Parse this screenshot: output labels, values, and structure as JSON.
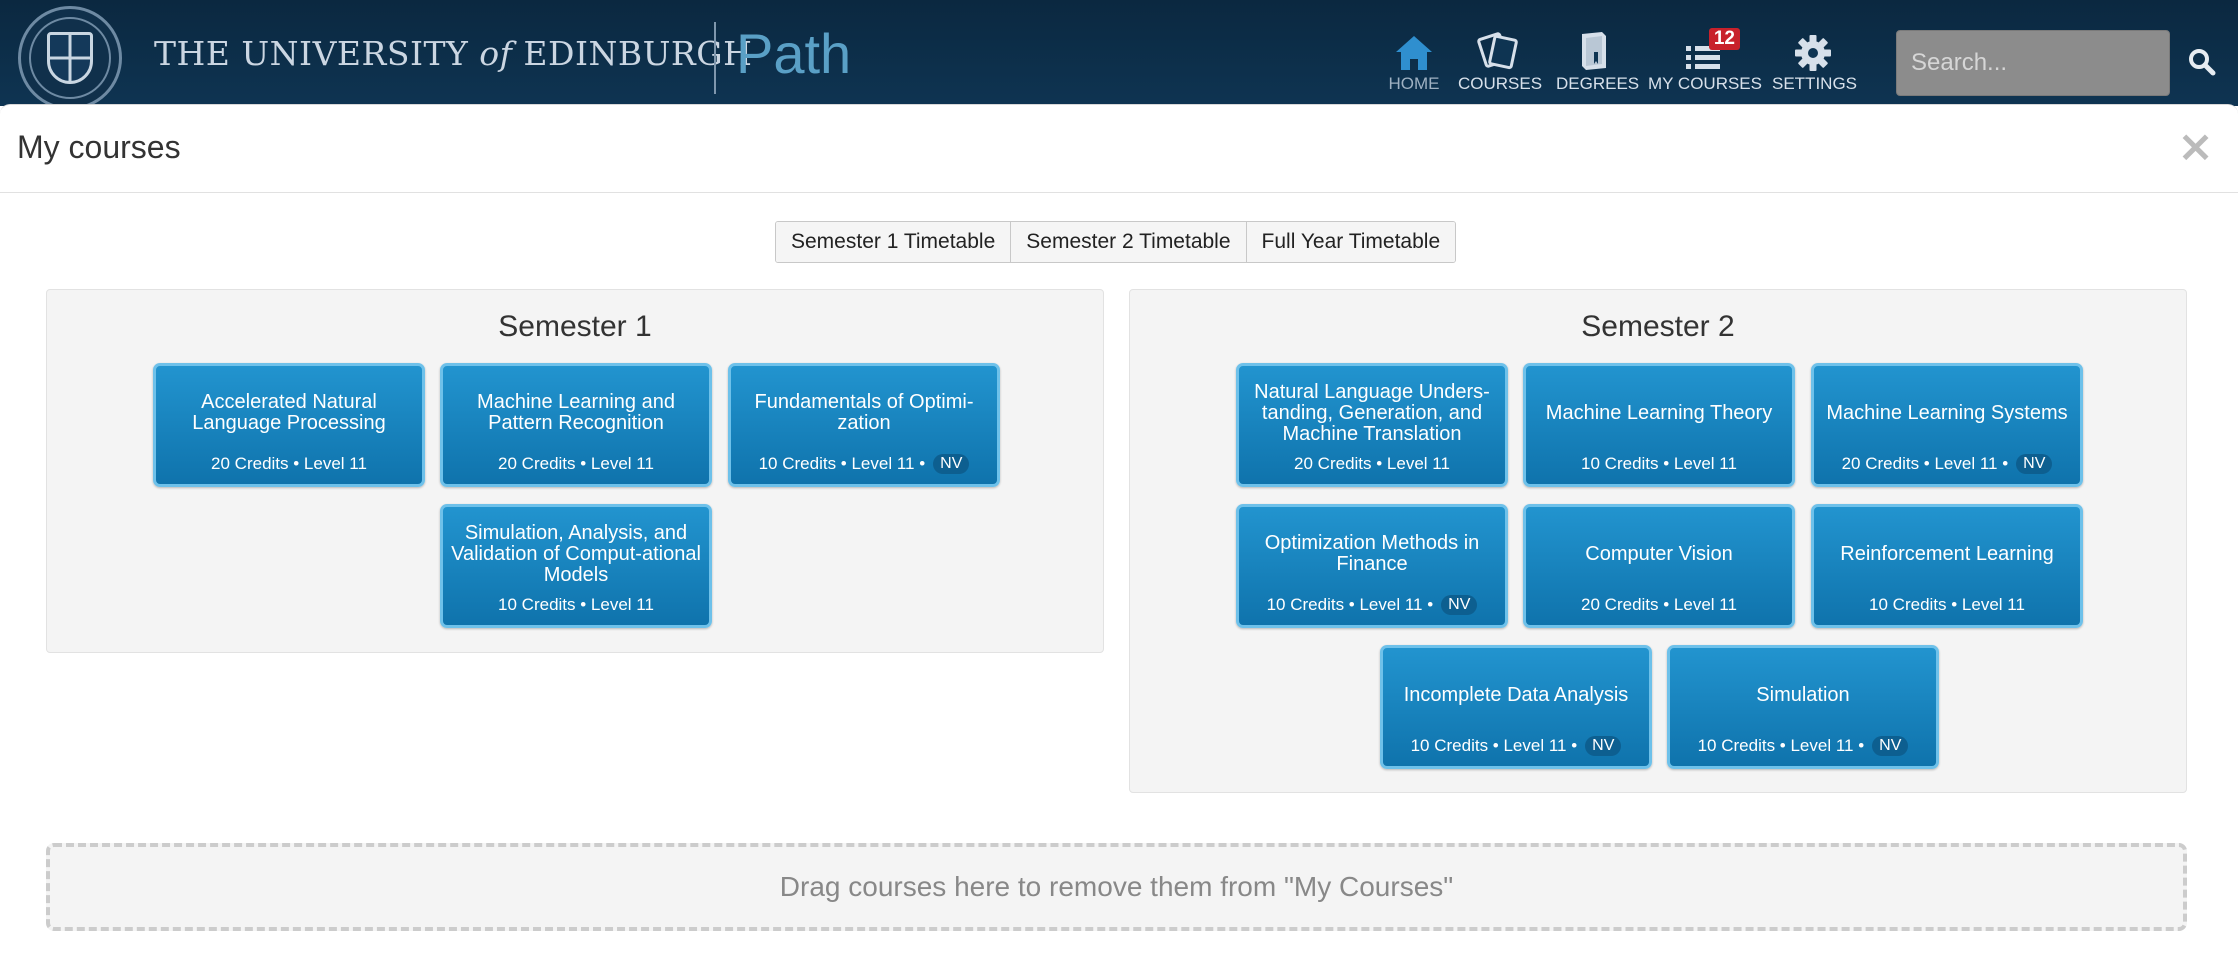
{
  "header": {
    "university_prefix": "THE UNIVERSITY",
    "university_of": "of",
    "university_suffix": "EDINBURGH",
    "app_name": "Path"
  },
  "nav": {
    "home": {
      "label": "HOME",
      "icon": "home-icon"
    },
    "courses": {
      "label": "COURSES",
      "icon": "courses-icon"
    },
    "degrees": {
      "label": "DEGREES",
      "icon": "degrees-icon"
    },
    "my_courses": {
      "label": "MY COURSES",
      "icon": "list-icon",
      "badge": "12"
    },
    "settings": {
      "label": "SETTINGS",
      "icon": "gear-icon"
    }
  },
  "search": {
    "placeholder": "Search...",
    "icon": "search-icon"
  },
  "modal": {
    "title": "My courses",
    "close_label": "×",
    "timetable_buttons": [
      "Semester 1 Timetable",
      "Semester 2 Timetable",
      "Full Year Timetable"
    ],
    "drop_zone_text": "Drag courses here to remove them from \"My Courses\""
  },
  "semesters": [
    {
      "title": "Semester 1",
      "courses": [
        {
          "title": "Accelerated Natural Language Processing",
          "meta": "20 Credits • Level 11",
          "nv": ""
        },
        {
          "title": "Machine Learning and Pattern Recognition",
          "meta": "20 Credits • Level 11",
          "nv": ""
        },
        {
          "title": "Fundamentals of Optimi-zation",
          "meta": "10 Credits • Level 11 •",
          "nv": "NV"
        },
        {
          "title": "Simulation, Analysis, and Validation of Comput-ational Models",
          "meta": "10 Credits • Level 11",
          "nv": ""
        }
      ]
    },
    {
      "title": "Semester 2",
      "courses": [
        {
          "title": "Natural Language Unders-tanding, Generation, and Machine Translation",
          "meta": "20 Credits • Level 11",
          "nv": ""
        },
        {
          "title": "Machine Learning Theory",
          "meta": "10 Credits • Level 11",
          "nv": ""
        },
        {
          "title": "Machine Learning Systems",
          "meta": "20 Credits • Level 11 •",
          "nv": "NV"
        },
        {
          "title": "Optimization Methods in Finance",
          "meta": "10 Credits • Level 11 •",
          "nv": "NV"
        },
        {
          "title": "Computer Vision",
          "meta": "20 Credits • Level 11",
          "nv": ""
        },
        {
          "title": "Reinforcement Learning",
          "meta": "10 Credits • Level 11",
          "nv": ""
        },
        {
          "title": "Incomplete Data Analysis",
          "meta": "10 Credits • Level 11 •",
          "nv": "NV"
        },
        {
          "title": "Simulation",
          "meta": "10 Credits • Level 11 •",
          "nv": "NV"
        }
      ]
    }
  ],
  "colors": {
    "topbar": "#0e3452",
    "card": "#1a85c2",
    "card_border": "#6ec1ea",
    "badge": "#c8212b",
    "brand_path": "#5aa0c6"
  }
}
